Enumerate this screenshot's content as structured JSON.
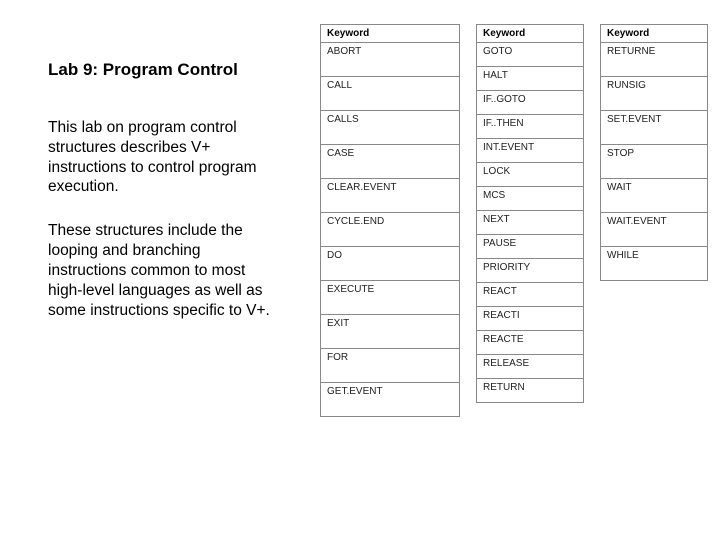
{
  "title": "Lab 9:  Program Control",
  "paragraph1": "This lab on program control structures describes V+  instructions to control program execution.",
  "paragraph2": "These structures include the looping and branching instructions common to most high-level languages as well as some instructions specific to V+.",
  "tables": {
    "header": "Keyword",
    "col1": [
      "ABORT",
      "CALL",
      "CALLS",
      "CASE",
      "CLEAR.EVENT",
      "CYCLE.END",
      "DO",
      "EXECUTE",
      "EXIT",
      "FOR",
      "GET.EVENT"
    ],
    "col2": [
      "GOTO",
      "HALT",
      "IF..GOTO",
      "IF..THEN",
      "INT.EVENT",
      "LOCK",
      "MCS",
      "NEXT",
      "PAUSE",
      "PRIORITY",
      "REACT",
      "REACTI",
      "REACTE",
      "RELEASE",
      "RETURN"
    ],
    "col3": [
      "RETURNE",
      "RUNSIG",
      "SET.EVENT",
      "STOP",
      "WAIT",
      "WAIT.EVENT",
      "WHILE"
    ]
  }
}
